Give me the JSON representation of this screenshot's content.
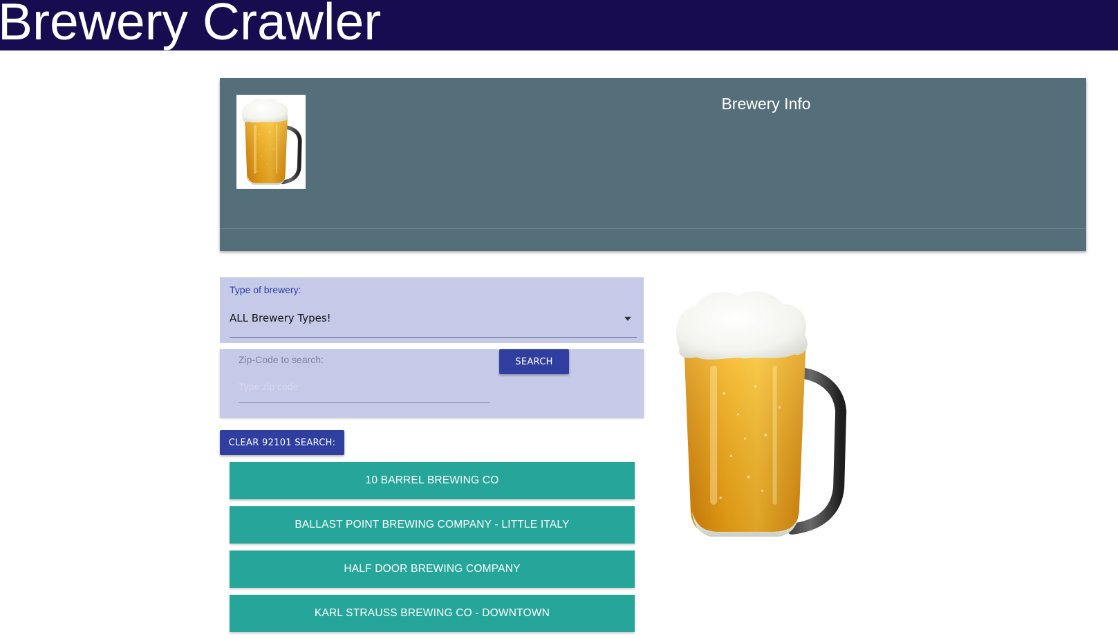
{
  "app": {
    "title": "Brewery Crawler"
  },
  "info_card": {
    "title": "Brewery Info",
    "thumbnail_icon": "beer-mug-icon"
  },
  "filter": {
    "type_label": "Type of brewery:",
    "type_value": "ALL Brewery Types!"
  },
  "zip_search": {
    "label": "Zip-Code to search:",
    "placeholder": "Type zip code",
    "search_label": "SEARCH"
  },
  "clear_button_label": "CLEAR 92101 SEARCH:",
  "breweries": [
    "10 BARREL BREWING CO",
    "BALLAST POINT BREWING COMPANY - LITTLE ITALY",
    "HALF DOOR BREWING COMPANY",
    "KARL STRAUSS BREWING CO - DOWNTOWN"
  ],
  "colors": {
    "header_bg": "#170c50",
    "info_card_bg": "#546e7a",
    "panel_bg": "#c5cae9",
    "primary_button": "#303f9f",
    "list_item": "#26a69a"
  }
}
